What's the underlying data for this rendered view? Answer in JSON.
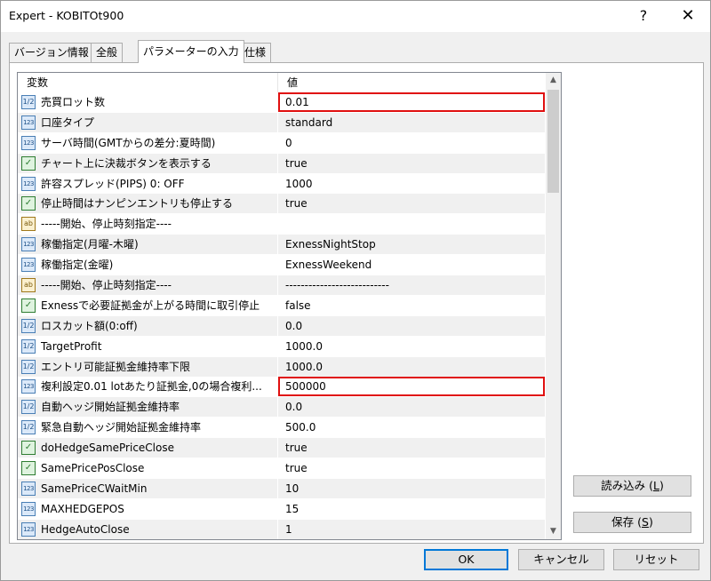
{
  "window": {
    "title": "Expert - KOBITOt900",
    "help": "?",
    "close": "✕"
  },
  "tabs": [
    {
      "label": "バージョン情報"
    },
    {
      "label": "全般"
    },
    {
      "label": "パラメーターの入力"
    },
    {
      "label": "仕様"
    }
  ],
  "grid": {
    "columns": {
      "name": "変数",
      "value": "値"
    },
    "rows": [
      {
        "icon": "1/2",
        "type": "double",
        "name": "売買ロット数",
        "value": "0.01",
        "highlight": true
      },
      {
        "icon": "123",
        "type": "int",
        "name": "口座タイプ",
        "value": "standard"
      },
      {
        "icon": "123",
        "type": "int",
        "name": "サーバ時間(GMTからの差分:夏時間)",
        "value": "0"
      },
      {
        "icon": "✓",
        "type": "bool",
        "name": "チャート上に決裁ボタンを表示する",
        "value": "true"
      },
      {
        "icon": "123",
        "type": "int",
        "name": "許容スプレッド(PIPS) 0: OFF",
        "value": "1000"
      },
      {
        "icon": "✓",
        "type": "bool",
        "name": "停止時間はナンピンエントリも停止する",
        "value": "true"
      },
      {
        "icon": "ab",
        "type": "str",
        "name": "-----開始、停止時刻指定----",
        "value": ""
      },
      {
        "icon": "123",
        "type": "int",
        "name": "稼働指定(月曜-木曜)",
        "value": "ExnessNightStop"
      },
      {
        "icon": "123",
        "type": "int",
        "name": "稼働指定(金曜)",
        "value": "ExnessWeekend"
      },
      {
        "icon": "ab",
        "type": "str",
        "name": "-----開始、停止時刻指定----",
        "value": "---------------------------"
      },
      {
        "icon": "✓",
        "type": "bool",
        "name": "Exnessで必要証拠金が上がる時間に取引停止",
        "value": "false"
      },
      {
        "icon": "1/2",
        "type": "double",
        "name": "ロスカット額(0:off)",
        "value": "0.0"
      },
      {
        "icon": "1/2",
        "type": "double",
        "name": "TargetProfit",
        "value": "1000.0"
      },
      {
        "icon": "1/2",
        "type": "double",
        "name": "エントリ可能証拠金維持率下限",
        "value": "1000.0"
      },
      {
        "icon": "123",
        "type": "int",
        "name": "複利設定0.01 lotあたり証拠金,0の場合複利...",
        "value": "500000",
        "highlight": true
      },
      {
        "icon": "1/2",
        "type": "double",
        "name": "自動ヘッジ開始証拠金維持率",
        "value": "0.0"
      },
      {
        "icon": "1/2",
        "type": "double",
        "name": "緊急自動ヘッジ開始証拠金維持率",
        "value": "500.0"
      },
      {
        "icon": "✓",
        "type": "bool",
        "name": "doHedgeSamePriceClose",
        "value": "true"
      },
      {
        "icon": "✓",
        "type": "bool",
        "name": "SamePricePosClose",
        "value": "true"
      },
      {
        "icon": "123",
        "type": "int",
        "name": "SamePriceCWaitMin",
        "value": "10"
      },
      {
        "icon": "123",
        "type": "int",
        "name": "MAXHEDGEPOS",
        "value": "15"
      },
      {
        "icon": "123",
        "type": "int",
        "name": "HedgeAutoClose",
        "value": "1"
      }
    ]
  },
  "buttons": {
    "load": {
      "text": "読み込み",
      "key": "L"
    },
    "save": {
      "text": "保存",
      "key": "S"
    },
    "ok": "OK",
    "cancel": "キャンセル",
    "reset": "リセット"
  },
  "colors": {
    "highlight": "#e01010",
    "default_button_border": "#0078d7"
  }
}
